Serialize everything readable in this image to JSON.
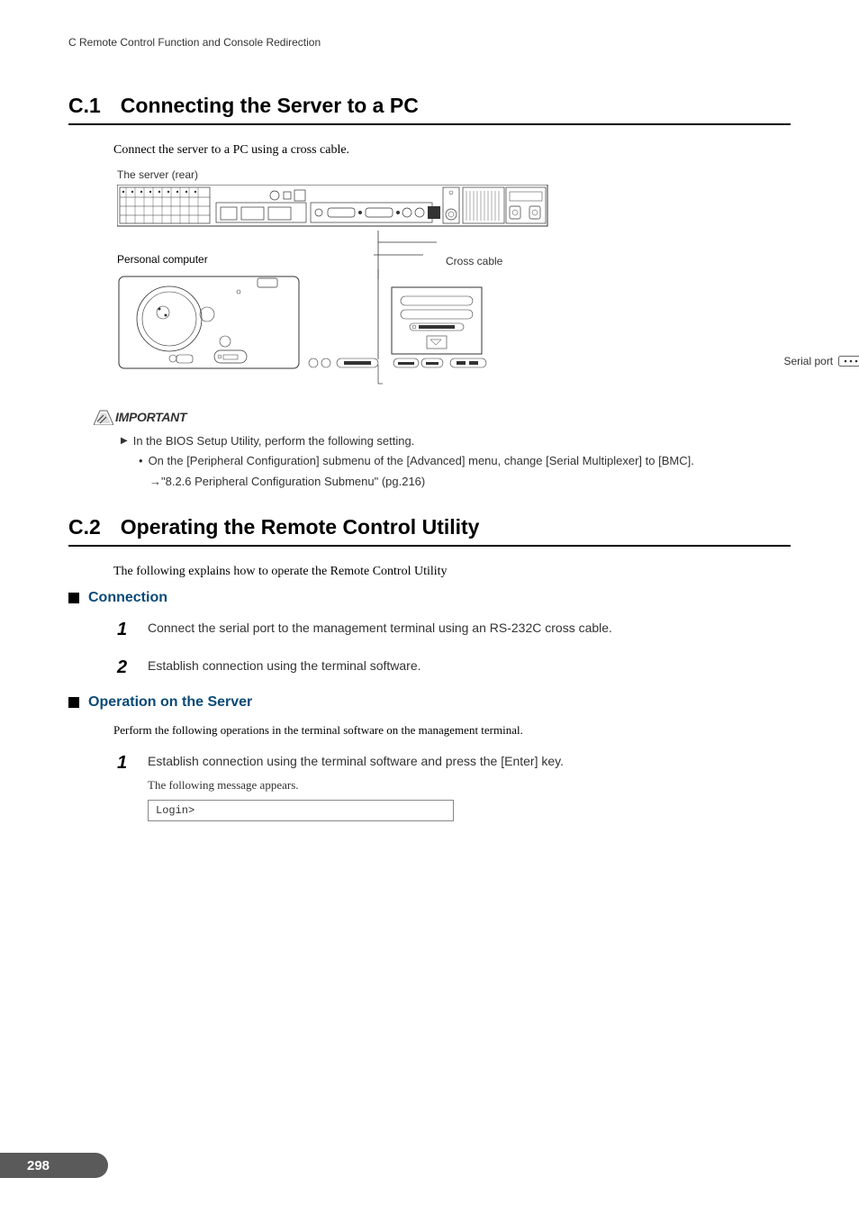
{
  "breadcrumb": "C  Remote Control Function and Console Redirection",
  "c1": {
    "num": "C.1",
    "title": "Connecting the Server to a PC",
    "intro": "Connect the server to a PC using a cross cable.",
    "serverLabel": "The server (rear)",
    "serialPort": "Serial port",
    "crossCable": "Cross cable",
    "pcLabel": "Personal computer"
  },
  "important": {
    "label": "IMPORTANT",
    "item1": "In the BIOS Setup Utility, perform the following setting.",
    "sub1": "On the [Peripheral Configuration] submenu of the [Advanced] menu, change [Serial Multiplexer] to [BMC].",
    "sub2": "→\"8.2.6 Peripheral Configuration Submenu\" (pg.216)"
  },
  "c2": {
    "num": "C.2",
    "title": "Operating the Remote Control Utility",
    "intro": "The following explains how to operate the Remote Control Utility"
  },
  "connection": {
    "header": "Connection",
    "step1": "Connect the serial port to the management terminal using an RS-232C cross cable.",
    "step2": "Establish connection using the terminal software."
  },
  "opServer": {
    "header": "Operation on the Server",
    "intro": "Perform the following operations in the terminal software on the management terminal.",
    "step1": "Establish connection using the terminal software and press the [Enter] key.",
    "step1sub": "The following message appears.",
    "code1": "Login>"
  },
  "pageNumber": "298"
}
